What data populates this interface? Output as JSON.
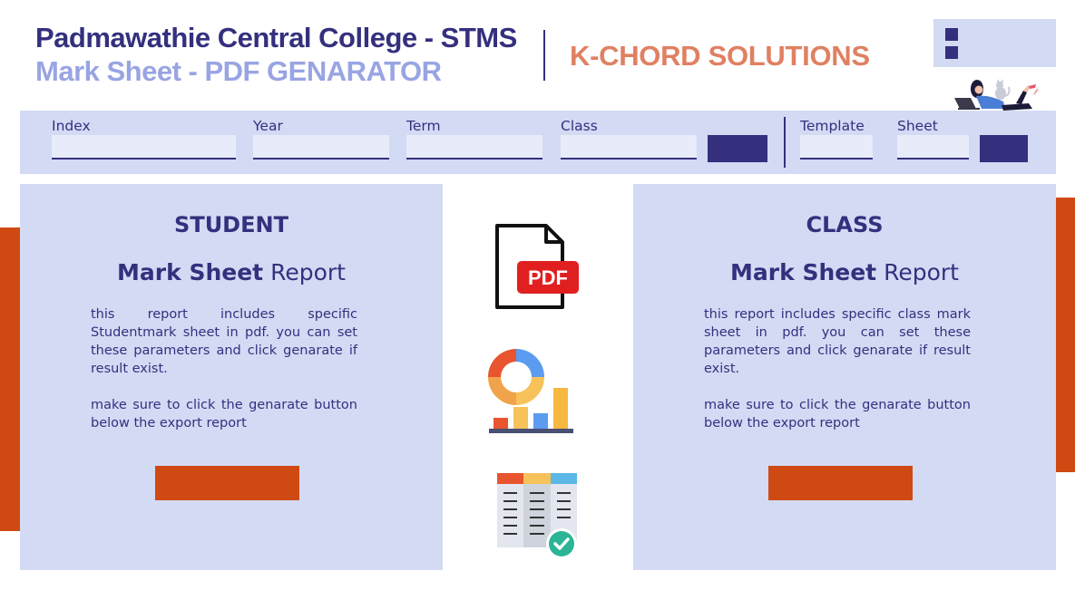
{
  "header": {
    "title": "Padmawathie Central College - STMS",
    "subtitle": "Mark Sheet - PDF GENARATOR",
    "brand": "K-CHORD SOLUTIONS"
  },
  "filters": {
    "index_label": "Index",
    "year_label": "Year",
    "term_label": "Term",
    "class_label": "Class",
    "template_label": "Template",
    "sheet_label": "Sheet",
    "index_value": "",
    "year_value": "",
    "term_value": "",
    "class_value": "",
    "template_value": "",
    "sheet_value": "",
    "search_button_label": "",
    "sheet_button_label": ""
  },
  "student_panel": {
    "title": "STUDENT",
    "subtitle_bold": "Mark Sheet",
    "subtitle_rest": " Report",
    "paragraph1": "this report includes specific Studentmark sheet in pdf. you can set these parameters and click genarate if result exist.",
    "paragraph2": "make sure to click the genarate button below the export report",
    "button_label": ""
  },
  "class_panel": {
    "title": "CLASS",
    "subtitle_bold": "Mark Sheet",
    "subtitle_rest": " Report",
    "paragraph1": "this report includes specific class mark sheet in pdf. you can set these parameters and click genarate if result exist.",
    "paragraph2": "make sure to click the genarate button below the export report",
    "button_label": ""
  },
  "icons": {
    "pdf_badge": "PDF",
    "pdf": "pdf-file-icon",
    "chart": "charts-icon",
    "sheet": "spreadsheet-check-icon",
    "illustration": "person-laptop-illustration",
    "menu": "menu-icon"
  },
  "colors": {
    "primary": "#34307e",
    "light_panel": "#d3daf4",
    "accent_orange": "#cf4a13",
    "brand": "#e08062",
    "subtitle": "#99a4e3"
  }
}
